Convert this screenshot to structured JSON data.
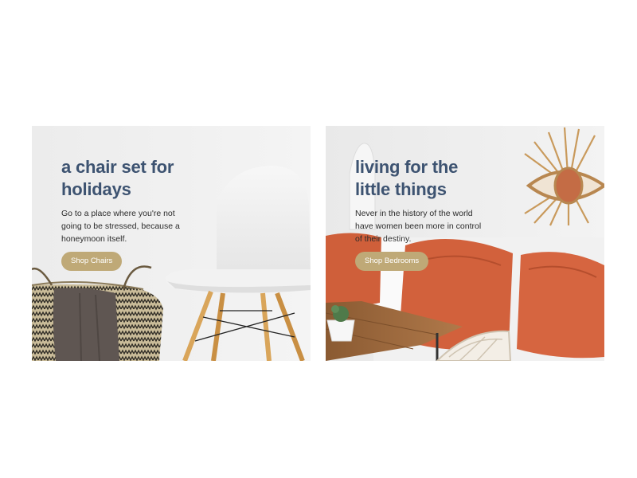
{
  "colors": {
    "heading": "#3d5371",
    "body_text": "#2b2b2b",
    "button_bg": "#bfa977",
    "button_text": "#ffffff",
    "cushion": "#d2613c"
  },
  "cards": [
    {
      "title": "a chair set for holidays",
      "description": "Go to a place where you're not going to be stressed, because a honeymoon itself.",
      "button_label": "Shop Chairs",
      "image": "white-chair-and-woven-basket"
    },
    {
      "title": "living for the little things",
      "description": "Never in the history of the world have women been more in control of their destiny.",
      "button_label": "Shop Bedrooms",
      "image": "orange-cushions-sofa-with-sun-mirror"
    }
  ]
}
